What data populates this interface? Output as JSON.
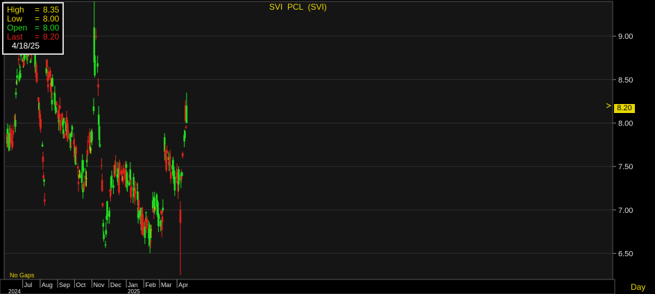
{
  "info": {
    "high": {
      "label": "High",
      "value": "8.35"
    },
    "low": {
      "label": "Low",
      "value": "8.00"
    },
    "open": {
      "label": "Open",
      "value": "8.00"
    },
    "last": {
      "label": "Last",
      "value": "8.20"
    },
    "date": "4/18/25"
  },
  "title": "SVI  PCL  (SVI)",
  "no_gaps": "No Gaps",
  "period": "Day",
  "last_price_tag": "8.20",
  "colors": {
    "background": "#000000",
    "panel": "#151515",
    "up": "#1fdd1f",
    "down": "#e2231a",
    "doji": "#e8d700",
    "axis_text": "#e0e0e0",
    "title": "#e8d700",
    "grid": "#2e2e2e"
  },
  "chart_data": {
    "type": "candlestick",
    "title": "SVI  PCL  (SVI)",
    "y_axis": {
      "ticks": [
        "6.50",
        "7.00",
        "7.50",
        "8.00",
        "8.50",
        "9.00"
      ],
      "range": [
        6.2,
        9.4
      ]
    },
    "x_axis": {
      "months": [
        "Jul",
        "Aug",
        "Sep",
        "Oct",
        "Nov",
        "Dec",
        "Jan",
        "Feb",
        "Mar",
        "Apr"
      ],
      "years": [
        "2024",
        "2025"
      ]
    },
    "series": [
      {
        "start": "2024-06-03",
        "end": "2024-06-14",
        "from": 7.85,
        "to": 7.85
      },
      {
        "start": "2024-06-17",
        "end": "2024-06-21",
        "from": 8.0,
        "to": 8.55
      },
      {
        "start": "2024-06-24",
        "end": "2024-07-05",
        "from": 8.55,
        "to": 8.85
      },
      {
        "start": "2024-07-08",
        "end": "2024-07-19",
        "from": 8.9,
        "to": 8.85
      },
      {
        "start": "2024-07-22",
        "end": "2024-08-02",
        "from": 8.85,
        "to": 7.95
      },
      {
        "start": "2024-08-05",
        "end": "2024-08-09",
        "from": 7.8,
        "to": 7.2
      },
      {
        "start": "2024-08-12",
        "end": "2024-08-23",
        "from": 8.6,
        "to": 8.35
      },
      {
        "start": "2024-08-26",
        "end": "2024-09-06",
        "from": 8.3,
        "to": 8.05
      },
      {
        "start": "2024-09-09",
        "end": "2024-09-20",
        "from": 8.05,
        "to": 7.9
      },
      {
        "start": "2024-09-23",
        "end": "2024-10-04",
        "from": 7.9,
        "to": 7.6
      },
      {
        "start": "2024-10-07",
        "end": "2024-10-18",
        "from": 7.5,
        "to": 7.35
      },
      {
        "start": "2024-10-21",
        "end": "2024-11-01",
        "from": 7.45,
        "to": 7.95
      },
      {
        "start": "2024-11-04",
        "end": "2024-11-08",
        "from": 8.2,
        "to": 9.0
      },
      {
        "start": "2024-11-11",
        "end": "2024-11-22",
        "from": 8.6,
        "to": 6.65
      },
      {
        "start": "2024-11-25",
        "end": "2024-12-06",
        "from": 6.75,
        "to": 7.3
      },
      {
        "start": "2024-12-09",
        "end": "2025-01-03",
        "from": 7.4,
        "to": 7.4
      },
      {
        "start": "2025-01-06",
        "end": "2025-01-24",
        "from": 7.4,
        "to": 7.05
      },
      {
        "start": "2025-01-27",
        "end": "2025-02-14",
        "from": 6.9,
        "to": 6.75
      },
      {
        "start": "2025-02-17",
        "end": "2025-03-07",
        "from": 7.1,
        "to": 6.9
      },
      {
        "start": "2025-03-10",
        "end": "2025-03-28",
        "from": 7.7,
        "to": 7.35
      },
      {
        "start": "2025-03-31",
        "end": "2025-04-11",
        "from": 7.3,
        "to": 7.55
      },
      {
        "start": "2025-04-14",
        "end": "2025-04-18",
        "from": 7.85,
        "to": 8.2
      }
    ],
    "special_bars": [
      {
        "date": "2024-11-05",
        "open": 8.7,
        "high": 9.4,
        "low": 8.6,
        "close": 9.1
      },
      {
        "date": "2025-04-07",
        "open": 7.0,
        "high": 7.1,
        "low": 6.25,
        "close": 6.85
      },
      {
        "date": "2025-04-18",
        "open": 8.0,
        "high": 8.35,
        "low": 8.0,
        "close": 8.2
      }
    ],
    "last": 8.2
  }
}
